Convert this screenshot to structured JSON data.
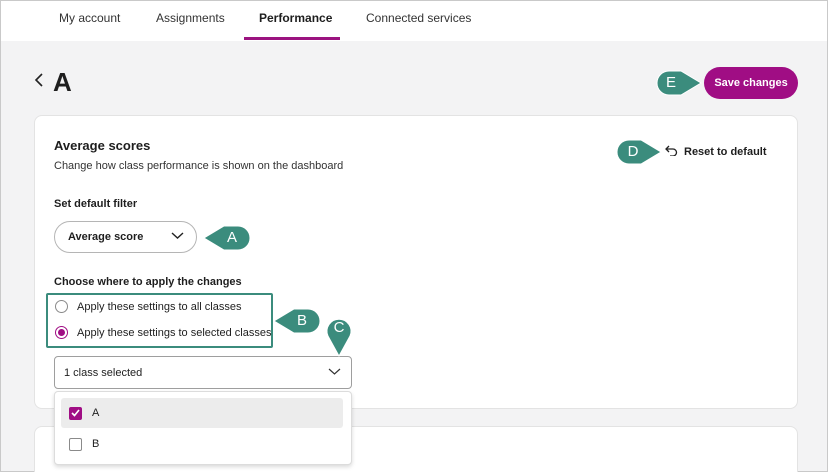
{
  "nav": {
    "tabs": [
      {
        "label": "My account"
      },
      {
        "label": "Assignments"
      },
      {
        "label": "Performance",
        "active": true
      },
      {
        "label": "Connected services"
      }
    ]
  },
  "header": {
    "title": "A",
    "save_label": "Save changes"
  },
  "card": {
    "title": "Average scores",
    "subtitle": "Change how class performance is shown on the dashboard",
    "reset_label": "Reset to default",
    "filter_label": "Set default filter",
    "filter_value": "Average score",
    "apply_label": "Choose where to apply the changes",
    "options": [
      {
        "label": "Apply these settings to all classes",
        "checked": false
      },
      {
        "label": "Apply these settings to selected classes",
        "checked": true
      }
    ],
    "class_select_value": "1 class selected",
    "class_items": [
      {
        "label": "A",
        "checked": true
      },
      {
        "label": "B",
        "checked": false
      }
    ]
  },
  "callouts": [
    "A",
    "B",
    "C",
    "D",
    "E"
  ],
  "colors": {
    "accent": "#a00d84",
    "callout": "#3b8c7d",
    "background": "#f3f3f4"
  }
}
